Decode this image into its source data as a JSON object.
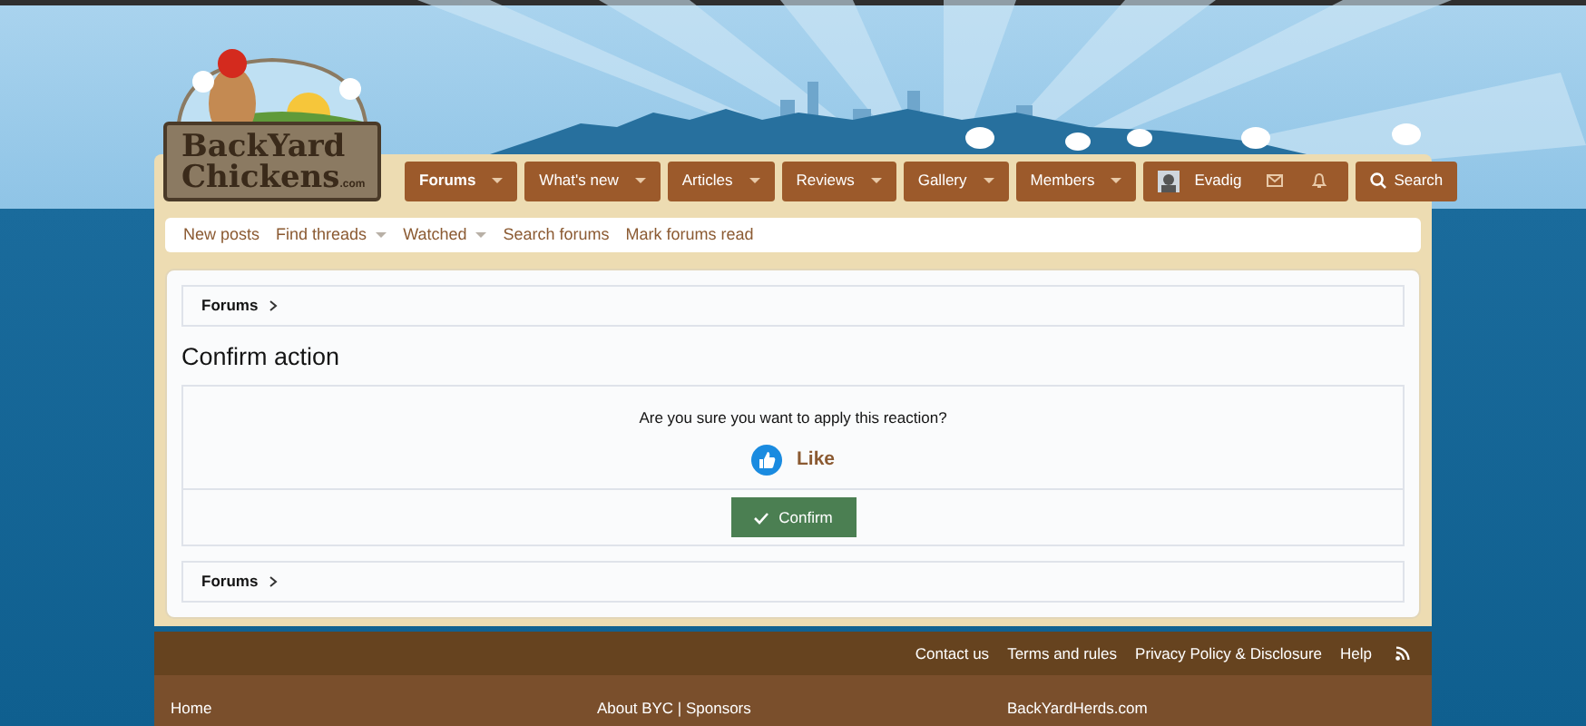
{
  "logo": {
    "line_1": "BackYard",
    "line_2": "Chickens",
    "suffix": ".com"
  },
  "nav": {
    "tabs": [
      {
        "label": "Forums",
        "selected": true,
        "has_menu": true
      },
      {
        "label": "What's new",
        "selected": false,
        "has_menu": true
      },
      {
        "label": "Articles",
        "selected": false,
        "has_menu": true
      },
      {
        "label": "Reviews",
        "selected": false,
        "has_menu": true
      },
      {
        "label": "Gallery",
        "selected": false,
        "has_menu": true
      },
      {
        "label": "Members",
        "selected": false,
        "has_menu": true
      }
    ],
    "user": {
      "name": "Evadig"
    },
    "search_button": "Search"
  },
  "subnav": [
    {
      "label": "New posts",
      "has_menu": false
    },
    {
      "label": "Find threads",
      "has_menu": true
    },
    {
      "label": "Watched",
      "has_menu": true
    },
    {
      "label": "Search forums",
      "has_menu": false
    },
    {
      "label": "Mark forums read",
      "has_menu": false
    }
  ],
  "breadcrumb_top": "Forums",
  "title": "Confirm action",
  "question": "Are you sure you want to apply this reaction?",
  "reaction": {
    "label": "Like"
  },
  "confirm_button": "Confirm",
  "breadcrumb_bottom": "Forums",
  "footer": {
    "links": [
      "Contact us",
      "Terms and rules",
      "Privacy Policy & Disclosure",
      "Help"
    ],
    "bottom_links": [
      "Home",
      "About BYC | Sponsors",
      "BackYardHerds.com"
    ]
  }
}
